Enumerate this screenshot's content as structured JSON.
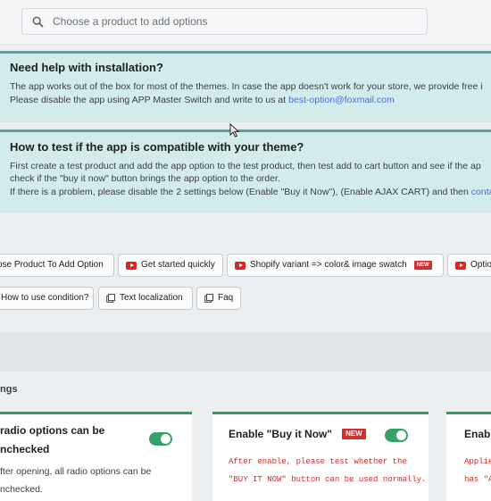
{
  "search": {
    "placeholder": "Choose a product to add options"
  },
  "help_banner": {
    "title": "Need help with installation?",
    "line1": "The app works out of the box for most of the themes. In case the app doesn't work for your store, we provide free i",
    "line2_prefix": "Please disable the app using APP Master Switch and write to us at ",
    "email": "best-option@foxmail.com"
  },
  "test_banner": {
    "title": "How to test if the app is compatible with your theme?",
    "line1": "First create a test product and add the app option to the test product, then test add to cart button and see if the ap",
    "line2": "check if the \"buy it now\" button brings the app option to the order.",
    "line3_prefix": "If there is a problem, please disable the 2 settings below (Enable \"Buy it Now\"), (Enable AJAX CART) and then ",
    "line3_link": "conta"
  },
  "buttons_row1": {
    "choose_product": "ose Product To Add Option",
    "get_started": "Get started quickly",
    "variant_swatch": "Shopify variant => color& image swatch",
    "new_badge": "NEW",
    "more": "Optio"
  },
  "buttons_row2": {
    "condition": "How to use condition?",
    "localization": "Text localization",
    "faq": "Faq"
  },
  "section": {
    "title": "ngs"
  },
  "cards": {
    "radio": {
      "title_line1": "radio options can be",
      "title_line2": "nchecked",
      "desc_line1": "fter opening, all radio options can be",
      "desc_line2": "nchecked.",
      "toggle_on": true
    },
    "buy_now": {
      "title": "Enable \"Buy it Now\"",
      "badge": "NEW",
      "note_line1": "After enable, please test whether the",
      "note_line2": "\"BUY IT NOW\" button can be used normally.",
      "toggle_on": true
    },
    "third": {
      "title": "Enab",
      "note_line1": "Applie",
      "note_line2": "has \"A"
    }
  },
  "colors": {
    "banner_bg": "#d3ebea",
    "banner_border": "#5b9fa4",
    "link": "#4a6ee0",
    "toggle_on": "#38a169",
    "card_accent": "#2e9e5a",
    "youtube": "#e02424"
  }
}
